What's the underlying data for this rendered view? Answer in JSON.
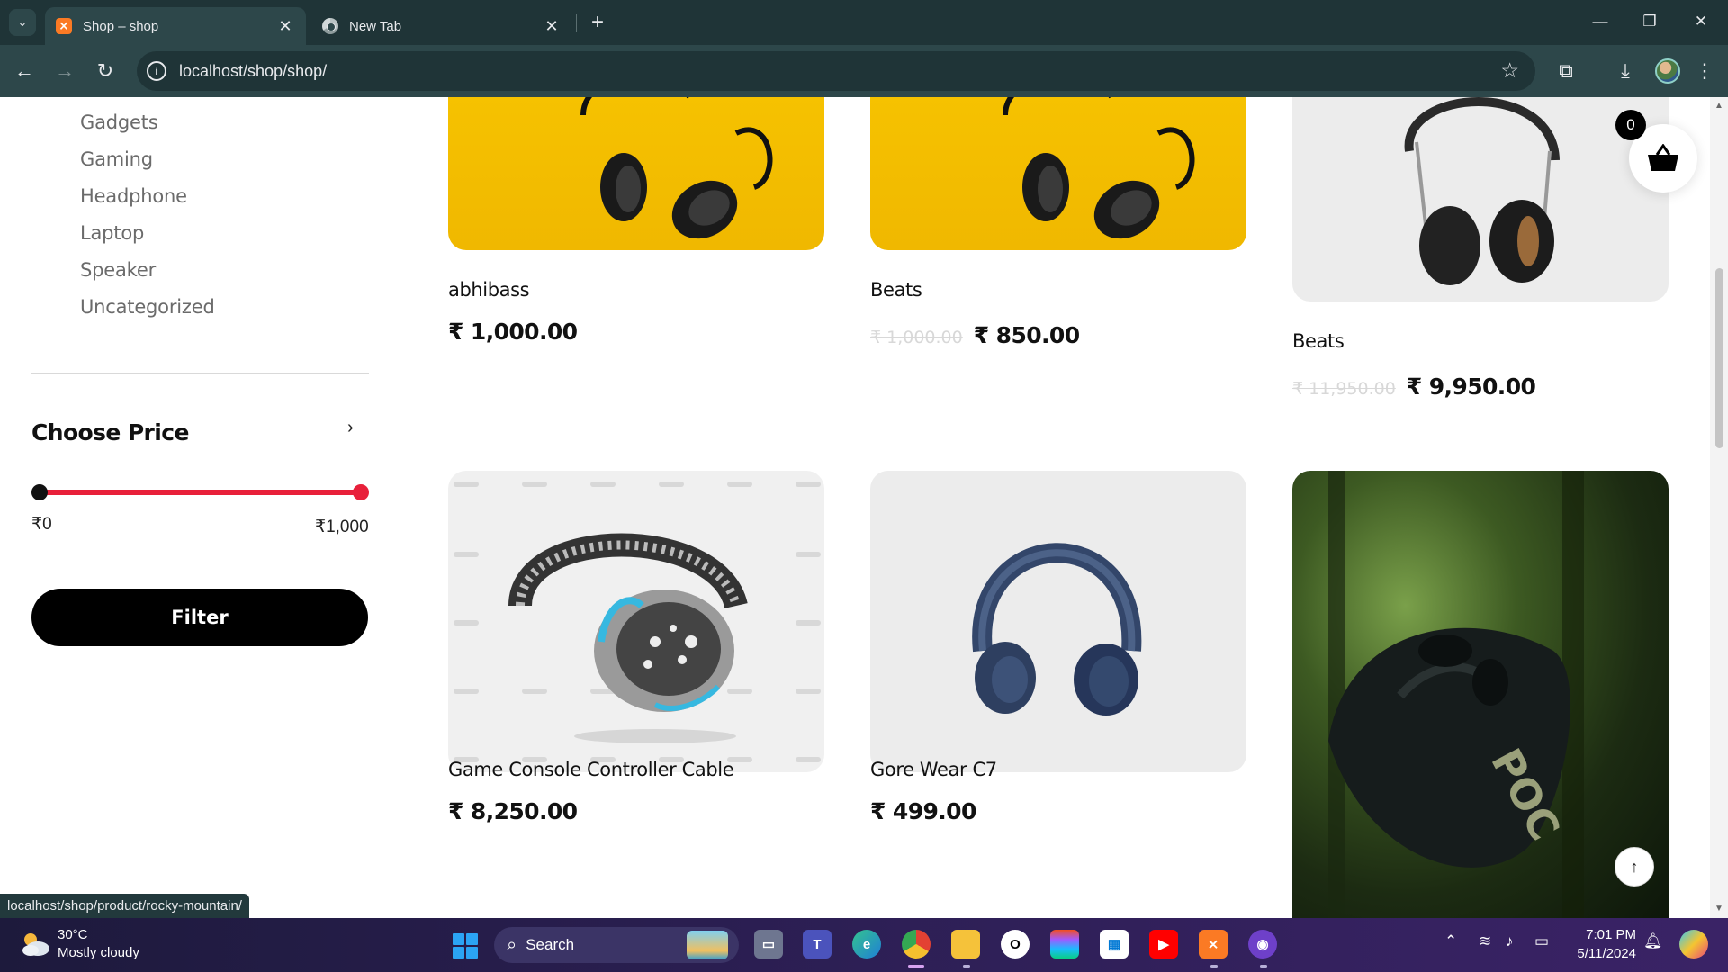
{
  "browser": {
    "tabs": [
      {
        "title": "Shop – shop",
        "active": true
      },
      {
        "title": "New Tab",
        "active": false
      }
    ],
    "url": "localhost/shop/shop/",
    "status_url": "localhost/shop/product/rocky-mountain/"
  },
  "sidebar": {
    "categories": [
      "Gadgets",
      "Gaming",
      "Headphone",
      "Laptop",
      "Speaker",
      "Uncategorized"
    ],
    "price_filter": {
      "title": "Choose Price",
      "min_label": "₹0",
      "max_label": "₹1,000",
      "button": "Filter",
      "colors": {
        "track": "#e8203a",
        "min_handle": "#111111",
        "max_handle": "#e8203a"
      }
    }
  },
  "cart": {
    "count": "0"
  },
  "products": [
    {
      "name": "abhibass",
      "old_price": "",
      "price": "₹ 1,000.00",
      "image": "headphones-on-yellow"
    },
    {
      "name": "Beats",
      "old_price": "₹ 1,000.00",
      "price": "₹ 850.00",
      "image": "headphones-on-yellow"
    },
    {
      "name": "Beats",
      "old_price": "₹ 11,950.00",
      "price": "₹ 9,950.00",
      "image": "black-headphones-on-grey"
    },
    {
      "name": "Game Console Controller Cable",
      "old_price": "",
      "price": "₹ 8,250.00",
      "image": "splatter-headphones"
    },
    {
      "name": "Gore Wear C7",
      "old_price": "",
      "price": "₹ 499.00",
      "image": "blue-headphones"
    },
    {
      "name": "",
      "old_price": "",
      "price": "",
      "image": "poc-helmet-forest"
    }
  ],
  "taskbar": {
    "weather_temp": "30°C",
    "weather_desc": "Mostly cloudy",
    "search_label": "Search",
    "time": "7:01 PM",
    "date": "5/11/2024"
  }
}
